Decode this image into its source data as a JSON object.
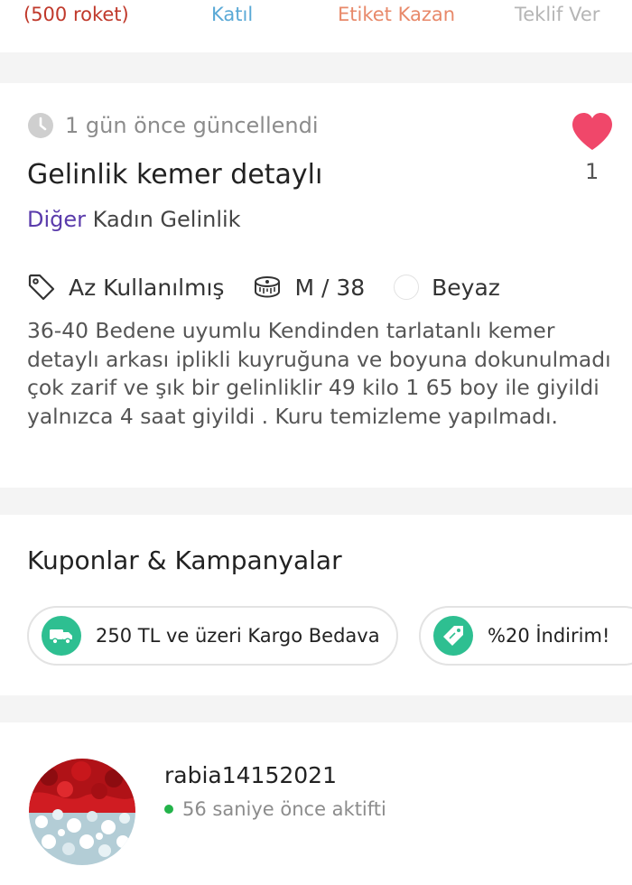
{
  "top_strip": {
    "items": [
      {
        "label": "(500 roket)",
        "color": "#c0392b"
      },
      {
        "label": "Katıl",
        "color": "#5aa9d6"
      },
      {
        "label": "Etiket Kazan",
        "color": "#e8896a"
      },
      {
        "label": "Teklif Ver",
        "color": "#b5b5b5"
      }
    ]
  },
  "listing": {
    "updated": "1 gün önce güncellendi",
    "title": "Gelinlik kemer detaylı",
    "likes": "1",
    "category_main": "Diğer",
    "category_sub": "Kadın Gelinlik",
    "attributes": {
      "condition": "Az Kullanılmış",
      "size": "M / 38",
      "color": "Beyaz"
    },
    "description": "36-40 Bedene uyumlu Kendinden tarlatanlı kemer detaylı arkası iplikli kuyruğuna ve boyuna dokunulmadı çok zarif ve şık bir gelinliklir 49 kilo 1 65 boy ile giyildi yalnızca 4 saat giyildi . Kuru temizleme yapılmadı."
  },
  "coupons": {
    "title": "Kuponlar & Kampanyalar",
    "items": [
      {
        "icon": "truck-icon",
        "label": "250 TL ve üzeri Kargo Bedava"
      },
      {
        "icon": "price-tag-icon",
        "label": "%20 İndirim!"
      }
    ]
  },
  "seller": {
    "username": "rabia14152021",
    "status": "56 saniye önce aktifti"
  },
  "colors": {
    "heart": "#f0476a",
    "category": "#5a3bab",
    "coupon_icon_bg": "#2ebf91",
    "online": "#23b34a"
  }
}
